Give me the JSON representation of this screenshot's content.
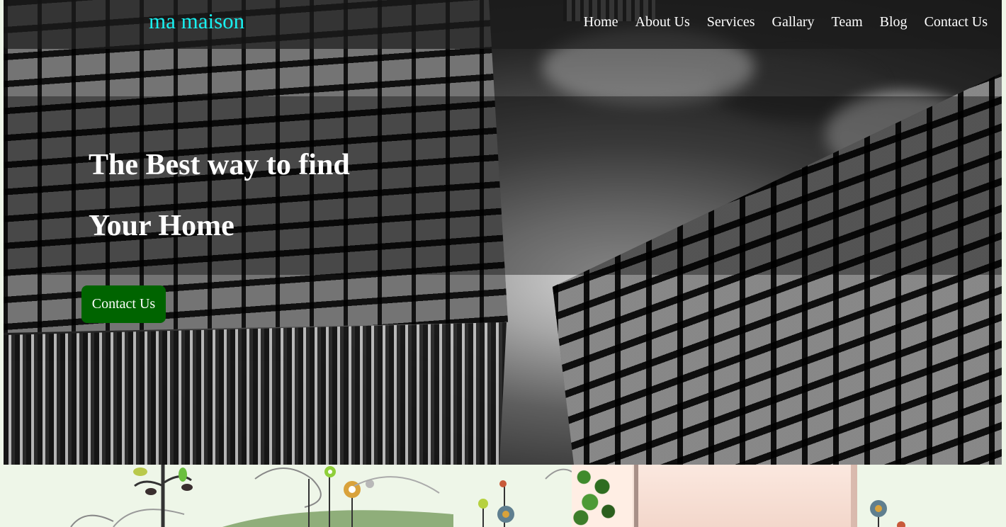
{
  "navbar": {
    "brand": "ma maison",
    "links": [
      {
        "label": "Home"
      },
      {
        "label": "About Us"
      },
      {
        "label": "Services"
      },
      {
        "label": "Gallary"
      },
      {
        "label": "Team"
      },
      {
        "label": "Blog"
      },
      {
        "label": "Contact Us"
      }
    ]
  },
  "hero": {
    "title_line1": "The Best way to find",
    "title_line2": "Your Home",
    "cta_label": "Contact Us"
  },
  "colors": {
    "brand": "#18f0f0",
    "cta_bg": "#006400",
    "nav_text": "#ffffff",
    "page_bg": "#eef6e8"
  },
  "images": {
    "hero_background": "skyscrapers-looking-up-grayscale",
    "bottom_left": "whimsical-plant-illustration",
    "bottom_right": "interior-room-photo-with-plant"
  }
}
